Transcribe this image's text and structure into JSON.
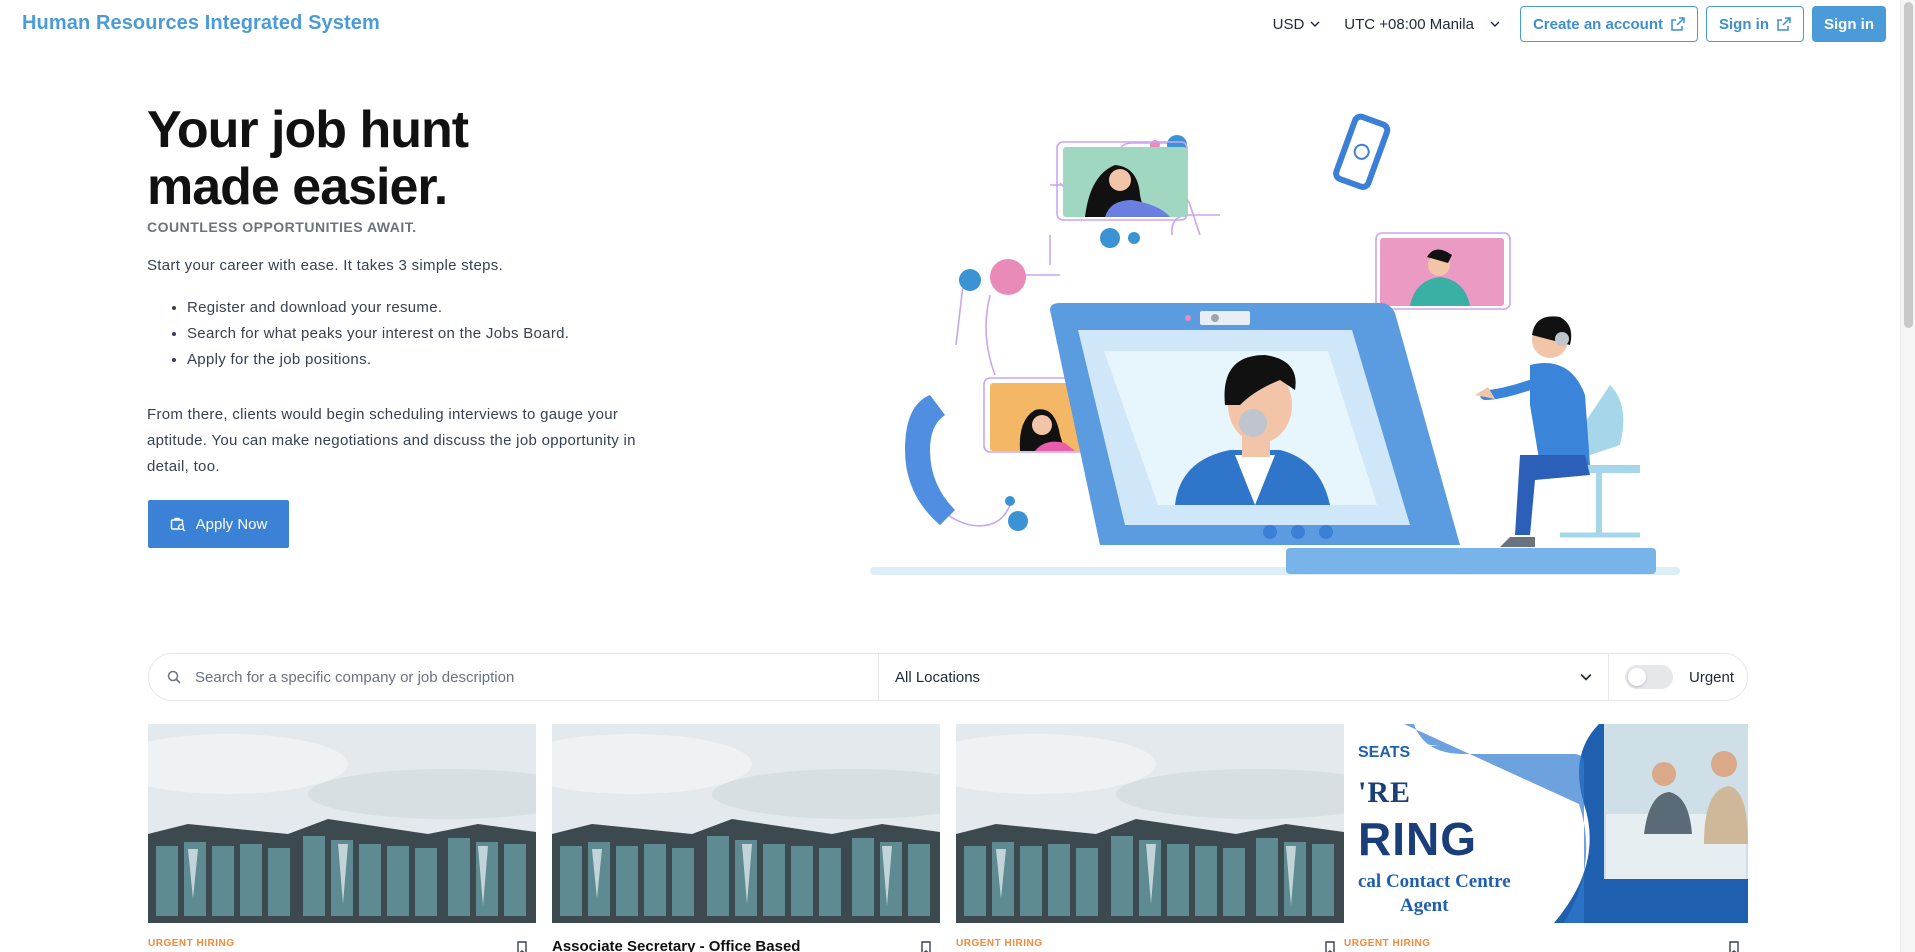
{
  "header": {
    "brand": "Human Resources Integrated System",
    "currency": "USD",
    "timezone": "UTC +08:00 Manila",
    "create_account": "Create an account",
    "sign_in_outline": "Sign in",
    "sign_in": "Sign in"
  },
  "hero": {
    "title_line1": "Your job hunt",
    "title_line2": "made easier.",
    "subtitle": "COUNTLESS OPPORTUNITIES AWAIT.",
    "intro": "Start your career with ease. It takes 3 simple steps.",
    "steps": [
      "Register and download your resume.",
      "Search for what peaks your interest on the Jobs Board.",
      "Apply for the job positions."
    ],
    "paragraph": "From there, clients would begin scheduling interviews to gauge your aptitude. You can make negotiations and discuss the job opportunity in detail, too.",
    "apply_label": "Apply Now"
  },
  "search": {
    "placeholder": "Search for a specific company or job description",
    "location": "All Locations",
    "urgent_label": "Urgent",
    "urgent_on": false
  },
  "cards": [
    {
      "tag": "URGENT HIRING",
      "title": ""
    },
    {
      "tag": "",
      "title": "Associate Secretary - Office Based"
    },
    {
      "tag": "URGENT HIRING",
      "title": ""
    },
    {
      "tag": "URGENT HIRING",
      "title": ""
    }
  ],
  "banner": {
    "line1": "SEATS",
    "line2": "'RE",
    "line3": "RING",
    "line4": "cal Contact Centre",
    "line5": "Agent"
  },
  "colors": {
    "brand": "#4a9bd8",
    "apply": "#3b82d6",
    "urgent": "#f08a3c"
  }
}
